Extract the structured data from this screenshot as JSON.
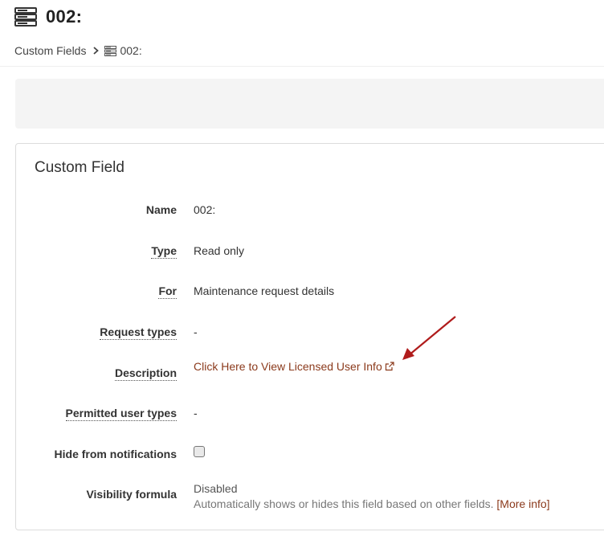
{
  "page": {
    "title": "002:",
    "title_icon": "server-stack-icon"
  },
  "breadcrumb": {
    "parent": "Custom Fields",
    "separator_icon": "chevron-right-icon",
    "current_icon": "server-stack-icon",
    "current": "002:"
  },
  "card": {
    "title": "Custom Field",
    "fields": {
      "name": {
        "label": "Name",
        "value": "002:"
      },
      "type": {
        "label": "Type",
        "value": "Read only"
      },
      "for": {
        "label": "For",
        "value": "Maintenance request details"
      },
      "request_types": {
        "label": "Request types",
        "value": "-"
      },
      "description": {
        "label": "Description",
        "link_text": "Click Here to View Licensed User Info",
        "link_icon": "external-link-icon"
      },
      "permitted_user_types": {
        "label": "Permitted user types",
        "value": "-"
      },
      "hide_from_notifications": {
        "label": "Hide from notifications",
        "checked": false
      },
      "visibility_formula": {
        "label": "Visibility formula",
        "status": "Disabled",
        "hint": "Automatically shows or hides this field based on other fields.",
        "more_link": "[More info]"
      }
    }
  },
  "annotation": {
    "arrow_color": "#b01c1c"
  },
  "colors": {
    "link": "#8b3a1c",
    "panel_bg": "#f4f4f4",
    "card_border": "#dcdcdc"
  }
}
